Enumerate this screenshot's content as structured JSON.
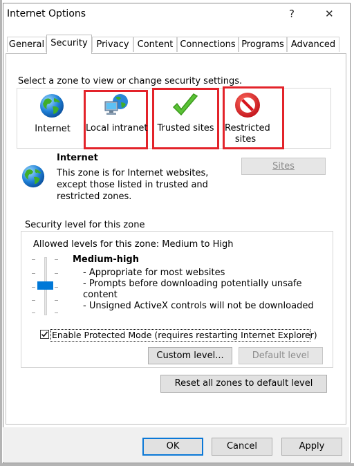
{
  "window": {
    "title": "Internet Options",
    "help_glyph": "?",
    "close_glyph": "✕"
  },
  "tabs": [
    "General",
    "Security",
    "Privacy",
    "Content",
    "Connections",
    "Programs",
    "Advanced"
  ],
  "zones": {
    "prompt": "Select a zone to view or change security settings.",
    "items": [
      {
        "label": "Internet",
        "icon": "globe-icon"
      },
      {
        "label": "Local intranet",
        "icon": "intranet-icon"
      },
      {
        "label": "Trusted sites",
        "icon": "checkmark-icon"
      },
      {
        "label_line1": "Restricted",
        "label_line2": "sites",
        "icon": "restricted-icon"
      }
    ],
    "highlight_color": "#e3232a"
  },
  "selected_zone": {
    "name": "Internet",
    "desc_line1": "This zone is for Internet websites,",
    "desc_line2": "except those listed in trusted and",
    "desc_line3": "restricted zones.",
    "sites_button": "Sites"
  },
  "security_level": {
    "group_label": "Security level for this zone",
    "allowed_levels": "Allowed levels for this zone: Medium to High",
    "level_name": "Medium-high",
    "bullet1": "- Appropriate for most websites",
    "bullet2a": "- Prompts before downloading potentially unsafe",
    "bullet2b": "content",
    "bullet3": "- Unsigned ActiveX controls will not be downloaded",
    "slider_level": "Medium-high"
  },
  "protected_mode": {
    "label": "Enable Protected Mode (requires restarting Internet Explorer)",
    "checked": true
  },
  "buttons": {
    "custom_level": "Custom level...",
    "default_level": "Default level",
    "reset_all": "Reset all zones to default level",
    "ok": "OK",
    "cancel": "Cancel",
    "apply": "Apply"
  },
  "colors": {
    "accent": "#0078d7",
    "highlight": "#e3232a"
  }
}
